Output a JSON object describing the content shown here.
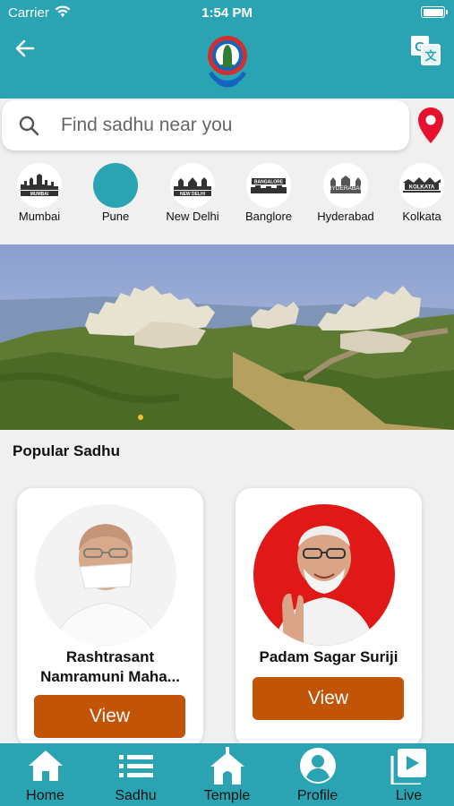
{
  "status_bar": {
    "carrier": "Carrier",
    "time": "1:54 PM"
  },
  "header": {
    "back_icon": "arrow-left-icon",
    "logo": "app-logo",
    "translate_icon": "translate-icon"
  },
  "search": {
    "placeholder": "Find sadhu near you",
    "value": ""
  },
  "cities": [
    {
      "name": "Mumbai",
      "selected": false
    },
    {
      "name": "Pune",
      "selected": true
    },
    {
      "name": "New Delhi",
      "selected": false
    },
    {
      "name": "Banglore",
      "selected": false
    },
    {
      "name": "Hyderabad",
      "selected": false
    },
    {
      "name": "Kolkata",
      "selected": false
    }
  ],
  "section": {
    "popular_title": "Popular Sadhu"
  },
  "sadhus": [
    {
      "name": "Rashtrasant Namramuni Maha...",
      "button": "View"
    },
    {
      "name": "Padam Sagar  Suriji",
      "button": "View"
    }
  ],
  "nav": [
    {
      "label": "Home",
      "icon": "home-icon"
    },
    {
      "label": "Sadhu",
      "icon": "list-icon"
    },
    {
      "label": "Temple",
      "icon": "temple-icon"
    },
    {
      "label": "Profile",
      "icon": "profile-icon"
    },
    {
      "label": "Live",
      "icon": "live-video-icon"
    }
  ],
  "colors": {
    "primary": "#2aa3b3",
    "button": "#c25408",
    "pin": "#e8112d"
  }
}
